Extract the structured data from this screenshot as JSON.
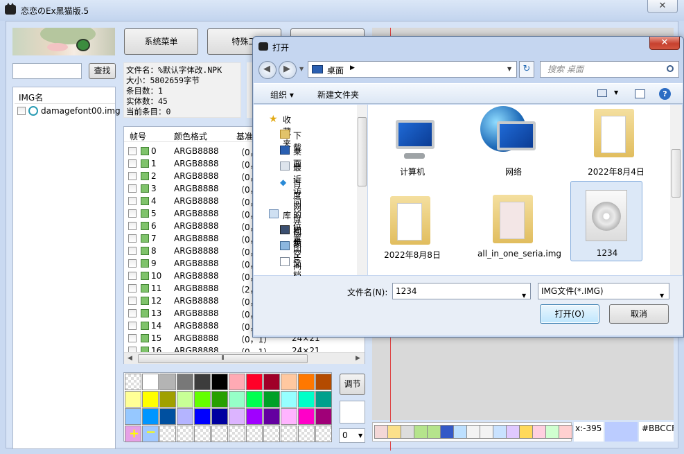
{
  "main": {
    "title": "恋恋のEx黑猫版.5",
    "close": "✕",
    "buttons": {
      "menu": "系统菜单",
      "special": "特殊工",
      "find": "查找"
    },
    "search_value": "",
    "imglist": {
      "header": "IMG名",
      "items": [
        "damagefont00.img"
      ]
    },
    "info": {
      "filename": "文件名：%默认字体改.NPK",
      "size": "大小：5802659字节",
      "entries": "条目数：1",
      "entities": "实体数：45",
      "current": "当前条目：0"
    },
    "frames": {
      "headers": [
        "帧号",
        "颜色格式",
        "基准"
      ],
      "rows": [
        {
          "n": "0",
          "c": "ARGB8888",
          "b": "（0，",
          "d": ""
        },
        {
          "n": "1",
          "c": "ARGB8888",
          "b": "（0，",
          "d": ""
        },
        {
          "n": "2",
          "c": "ARGB8888",
          "b": "（0，",
          "d": ""
        },
        {
          "n": "3",
          "c": "ARGB8888",
          "b": "（0，",
          "d": ""
        },
        {
          "n": "4",
          "c": "ARGB8888",
          "b": "（0，",
          "d": ""
        },
        {
          "n": "5",
          "c": "ARGB8888",
          "b": "（0，",
          "d": ""
        },
        {
          "n": "6",
          "c": "ARGB8888",
          "b": "（0，",
          "d": ""
        },
        {
          "n": "7",
          "c": "ARGB8888",
          "b": "（0，",
          "d": ""
        },
        {
          "n": "8",
          "c": "ARGB8888",
          "b": "（0，",
          "d": ""
        },
        {
          "n": "9",
          "c": "ARGB8888",
          "b": "（0，",
          "d": ""
        },
        {
          "n": "10",
          "c": "ARGB8888",
          "b": "（0，",
          "d": ""
        },
        {
          "n": "11",
          "c": "ARGB8888",
          "b": "（2，",
          "d": ""
        },
        {
          "n": "12",
          "c": "ARGB8888",
          "b": "（0，",
          "d": ""
        },
        {
          "n": "13",
          "c": "ARGB8888",
          "b": "（0，",
          "d": ""
        },
        {
          "n": "14",
          "c": "ARGB8888",
          "b": "（0，",
          "d": ""
        },
        {
          "n": "15",
          "c": "ARGB8888",
          "b": "（0，1）",
          "d": "24×21"
        },
        {
          "n": "16",
          "c": "ARGB8888",
          "b": "（0，1）",
          "d": "24×21"
        }
      ]
    },
    "adjust": "调节",
    "zoom": "0",
    "coord": "x:-395",
    "hex": "#BBCCFF",
    "palette": [
      [
        "chk",
        "#ffffff",
        "#b4b4b4",
        "#787878",
        "#3c3c3c",
        "#000000",
        "#ffaab4",
        "#ff0028",
        "#a00028",
        "#ffc8a0",
        "#ff7800",
        "#b44b00"
      ],
      [
        "#ffff96",
        "#ffff00",
        "#a0a000",
        "#c8ff96",
        "#64ff00",
        "#28a000",
        "#96ffc8",
        "#00ff50",
        "#00a028",
        "#96ffff",
        "#00ffc8",
        "#00a08c"
      ],
      [
        "#96c8ff",
        "#0096ff",
        "#0050a0",
        "#b4b4ff",
        "#0000ff",
        "#0000a0",
        "#dcb4ff",
        "#a000ff",
        "#6400a0",
        "#ffb4ff",
        "#ff00c8",
        "#a00078"
      ],
      [
        "plus",
        "minus",
        "chk",
        "chk",
        "chk",
        "chk",
        "chk",
        "chk",
        "chk",
        "chk",
        "chk",
        "chk"
      ]
    ]
  },
  "dialog": {
    "title": "打开",
    "close": "✕",
    "address": "桌面",
    "search_placeholder": "搜索 桌面",
    "organize": "组织 ▾",
    "new_folder": "新建文件夹",
    "nav": {
      "favorites": "收藏夹",
      "downloads": "下载",
      "desktop": "桌面",
      "recent": "最近访问的位置",
      "baidu": "百度网盘同步空间",
      "library": "库",
      "videos": "视频",
      "pictures": "图片",
      "documents": "文档"
    },
    "files": [
      {
        "name": "计算机",
        "icon": "computer-icon"
      },
      {
        "name": "网络",
        "icon": "network-icon"
      },
      {
        "name": "2022年8月4日",
        "icon": "folder-icon"
      },
      {
        "name": "2022年8月8日",
        "icon": "folder-icon"
      },
      {
        "name": "all_in_one_seria.img",
        "icon": "img-folder-icon"
      },
      {
        "name": "1234",
        "icon": "disc-file-icon"
      }
    ],
    "filename_label": "文件名(N):",
    "filename_value": "1234",
    "filetype": "IMG文件(*.IMG)",
    "open": "打开(O)",
    "cancel": "取消"
  }
}
